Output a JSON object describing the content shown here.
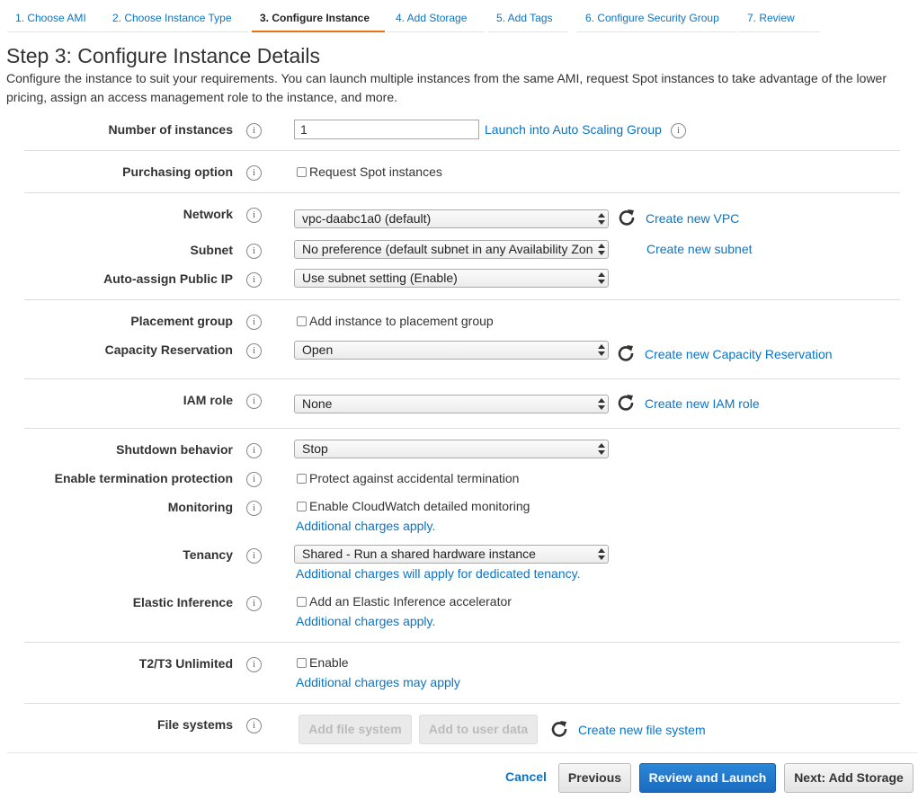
{
  "tabs": [
    "1. Choose AMI",
    "2. Choose Instance Type",
    "3. Configure Instance",
    "4. Add Storage",
    "5. Add Tags",
    "6. Configure Security Group",
    "7. Review"
  ],
  "heading": "Step 3: Configure Instance Details",
  "description": "Configure the instance to suit your requirements. You can launch multiple instances from the same AMI, request Spot instances to take advantage of the lower pricing, assign an access management role to the instance, and more.",
  "info_glyph": "i",
  "fields": {
    "num_instances": {
      "label": "Number of instances",
      "value": "1",
      "link": "Launch into Auto Scaling Group"
    },
    "purchasing": {
      "label": "Purchasing option",
      "checkbox": "Request Spot instances"
    },
    "network": {
      "label": "Network",
      "value": "vpc-daabc1a0 (default)",
      "link": "Create new VPC"
    },
    "subnet": {
      "label": "Subnet",
      "value": "No preference (default subnet in any Availability Zon",
      "link": "Create new subnet"
    },
    "public_ip": {
      "label": "Auto-assign Public IP",
      "value": "Use subnet setting (Enable)"
    },
    "placement": {
      "label": "Placement group",
      "checkbox": "Add instance to placement group"
    },
    "capacity": {
      "label": "Capacity Reservation",
      "value": "Open",
      "link": "Create new Capacity Reservation"
    },
    "iam": {
      "label": "IAM role",
      "value": "None",
      "link": "Create new IAM role"
    },
    "shutdown": {
      "label": "Shutdown behavior",
      "value": "Stop"
    },
    "termination": {
      "label": "Enable termination protection",
      "checkbox": "Protect against accidental termination"
    },
    "monitoring": {
      "label": "Monitoring",
      "checkbox": "Enable CloudWatch detailed monitoring",
      "note": "Additional charges apply."
    },
    "tenancy": {
      "label": "Tenancy",
      "value": "Shared - Run a shared hardware instance",
      "note": "Additional charges will apply for dedicated tenancy."
    },
    "elastic": {
      "label": "Elastic Inference",
      "checkbox": "Add an Elastic Inference accelerator",
      "note": "Additional charges apply."
    },
    "t2t3": {
      "label": "T2/T3 Unlimited",
      "checkbox": "Enable",
      "note": "Additional charges may apply"
    },
    "filesystems": {
      "label": "File systems",
      "btn_add": "Add file system",
      "btn_user_data": "Add to user data",
      "link": "Create new file system"
    }
  },
  "footer": {
    "cancel": "Cancel",
    "previous": "Previous",
    "review": "Review and Launch",
    "next": "Next: Add Storage"
  }
}
